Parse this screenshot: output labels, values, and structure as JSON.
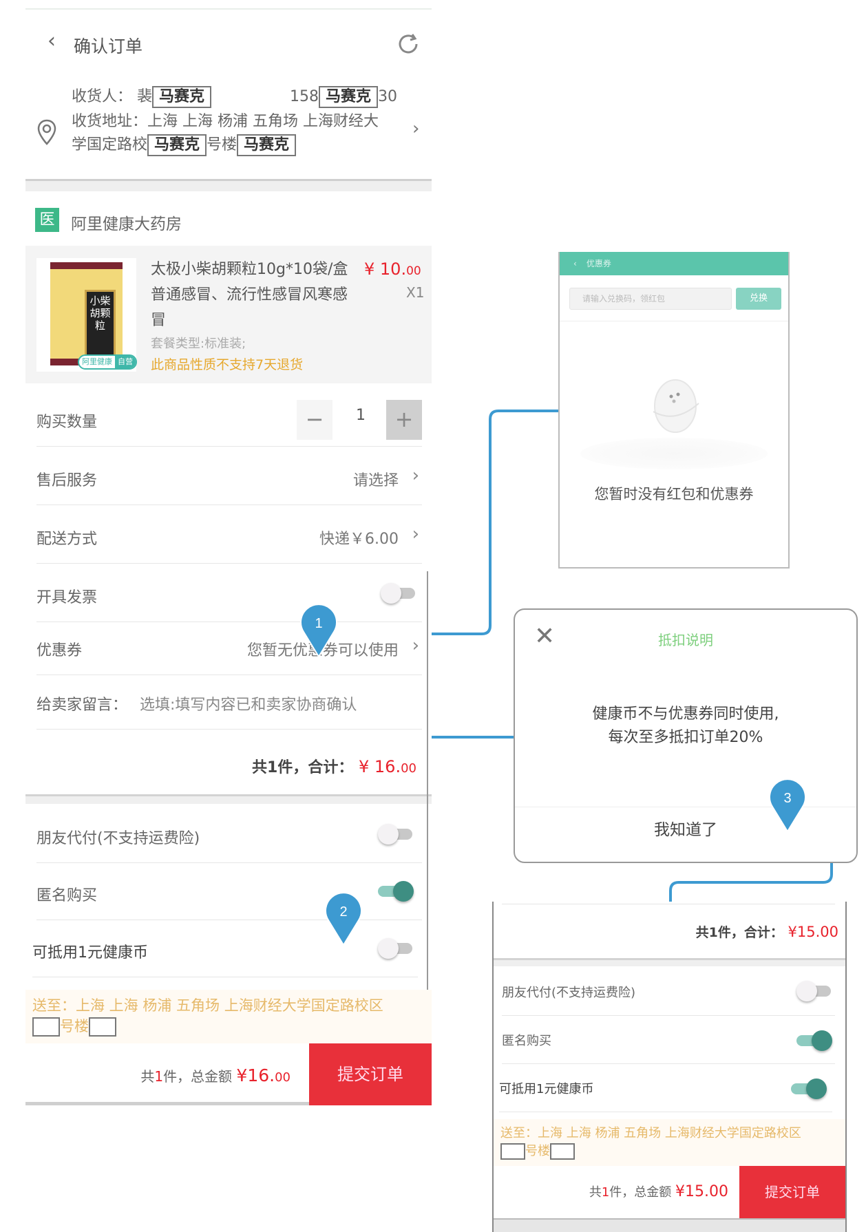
{
  "main": {
    "nav": {
      "title": "确认订单",
      "back_icon": "‹"
    },
    "address": {
      "receiver_label": "收货人：",
      "receiver_name_prefix": "裴",
      "mask_text": "马赛克",
      "phone_prefix": "158",
      "phone_suffix": "30",
      "address_label": "收货地址：",
      "address_line1": "上海 上海 杨浦 五角场 上海财经大",
      "address_line2_prefix": "学国定路校",
      "address_line2_mid": "号楼"
    },
    "store": {
      "badge": "医",
      "name": "阿里健康大药房"
    },
    "product": {
      "title": "太极小柴胡颗粒10g*10袋/盒 普通感冒、流行性感冒风寒感冒",
      "price_main": "¥ 10.",
      "price_cents": "00",
      "quantity_label": "X1",
      "package": "套餐类型:标准装;",
      "warning": "此商品性质不支持7天退货",
      "image_label": "小柴胡颗粒",
      "tag_brand": "阿里健康",
      "tag_self": "自营"
    },
    "rows": {
      "quantity": {
        "label": "购买数量",
        "value": "1",
        "minus": "−",
        "plus": "+"
      },
      "after_sales": {
        "label": "售后服务",
        "value": "请选择"
      },
      "delivery": {
        "label": "配送方式",
        "value": "快递￥6.00"
      },
      "invoice": {
        "label": "开具发票",
        "on": false
      },
      "coupon": {
        "label": "优惠券",
        "value": "您暂无优惠券可以使用"
      },
      "message": {
        "label": "给卖家留言：",
        "placeholder": "选填:填写内容已和卖家协商确认"
      }
    },
    "subtotal": {
      "text": "共1件，合计：",
      "amount_main": "¥ 16.",
      "amount_cents": "00"
    },
    "options": {
      "friend_pay": {
        "label": "朋友代付(不支持运费险)",
        "on": false
      },
      "anonymous": {
        "label": "匿名购买",
        "on": true
      },
      "health_coin": {
        "label": "可抵用1元健康币",
        "on": false
      }
    },
    "ship_to": {
      "text": "送至：上海 上海 杨浦 五角场 上海财经大学国定路校区",
      "line2": "号楼"
    },
    "bottom": {
      "prefix": "共",
      "count": "1",
      "suffix": "件，总金额",
      "amount_main": "¥16.",
      "amount_cents": "00",
      "submit": "提交订单"
    }
  },
  "coupon_panel": {
    "title": "优惠券",
    "input_placeholder": "请输入兑换码，领红包",
    "redeem_button": "兑换",
    "empty_text": "您暂时没有红包和优惠券"
  },
  "dialog": {
    "title": "抵扣说明",
    "body_line1": "健康币不与优惠券同时使用,",
    "body_line2": "每次至多抵扣订单20%",
    "ok_button": "我知道了"
  },
  "result_panel": {
    "subtotal": {
      "text": "共1件，合计：",
      "amount": "¥15.00"
    },
    "options": {
      "friend_pay": {
        "label": "朋友代付(不支持运费险)",
        "on": false
      },
      "anonymous": {
        "label": "匿名购买",
        "on": true
      },
      "health_coin": {
        "label": "可抵用1元健康币",
        "on": true
      }
    },
    "ship_to": {
      "text": "送至：上海 上海 杨浦 五角场 上海财经大学国定路校区",
      "line2": "号楼"
    },
    "bottom": {
      "prefix": "共",
      "count": "1",
      "suffix": "件，总金额",
      "amount": "¥15.00",
      "submit": "提交订单"
    }
  },
  "callouts": [
    {
      "number": "1",
      "color": "#3d9ad1"
    },
    {
      "number": "2",
      "color": "#3d9ad1"
    },
    {
      "number": "3",
      "color": "#3d9ad1"
    }
  ],
  "colors": {
    "accent_green": "#5bc5ab",
    "price_red": "#e8222c",
    "submit_red": "#e8303a",
    "toggle_on": "#3e8e82",
    "warning_orange": "#e6a82e",
    "callout_blue": "#3d9ad1"
  }
}
